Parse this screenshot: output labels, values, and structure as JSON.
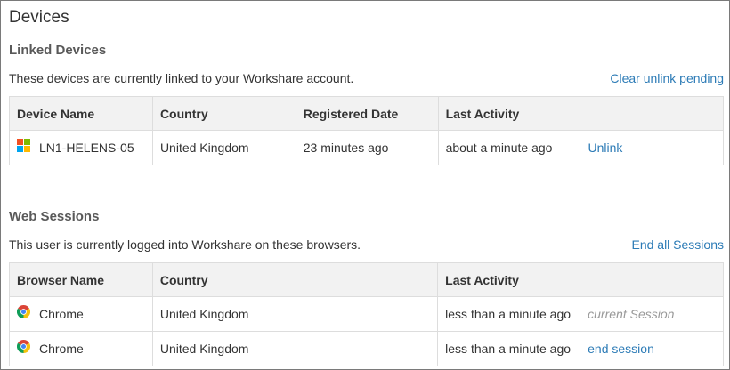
{
  "page": {
    "title": "Devices"
  },
  "linked_devices": {
    "title": "Linked Devices",
    "description": "These devices are currently linked to your Workshare account.",
    "action_label": "Clear unlink pending",
    "columns": [
      "Device Name",
      "Country",
      "Registered Date",
      "Last Activity",
      ""
    ],
    "rows": [
      {
        "icon": "windows-icon",
        "device_name": "LN1-HELENS-05",
        "country": "United Kingdom",
        "registered": "23 minutes ago",
        "last_activity": "about a minute ago",
        "action": "Unlink"
      }
    ]
  },
  "web_sessions": {
    "title": "Web Sessions",
    "description": "This user is currently logged into Workshare on these browsers.",
    "action_label": "End all Sessions",
    "columns": [
      "Browser Name",
      "Country",
      "",
      "Last Activity",
      ""
    ],
    "rows": [
      {
        "icon": "chrome-icon",
        "browser": "Chrome",
        "country": "United Kingdom",
        "last_activity": "less than a minute ago",
        "status": "current Session"
      },
      {
        "icon": "chrome-icon",
        "browser": "Chrome",
        "country": "United Kingdom",
        "last_activity": "less than a minute ago",
        "action": "end session"
      }
    ]
  },
  "colors": {
    "link": "#2c7bb6",
    "header_bg": "#f2f2f2",
    "border": "#dddddd",
    "section_title": "#595959",
    "muted": "#999999"
  }
}
